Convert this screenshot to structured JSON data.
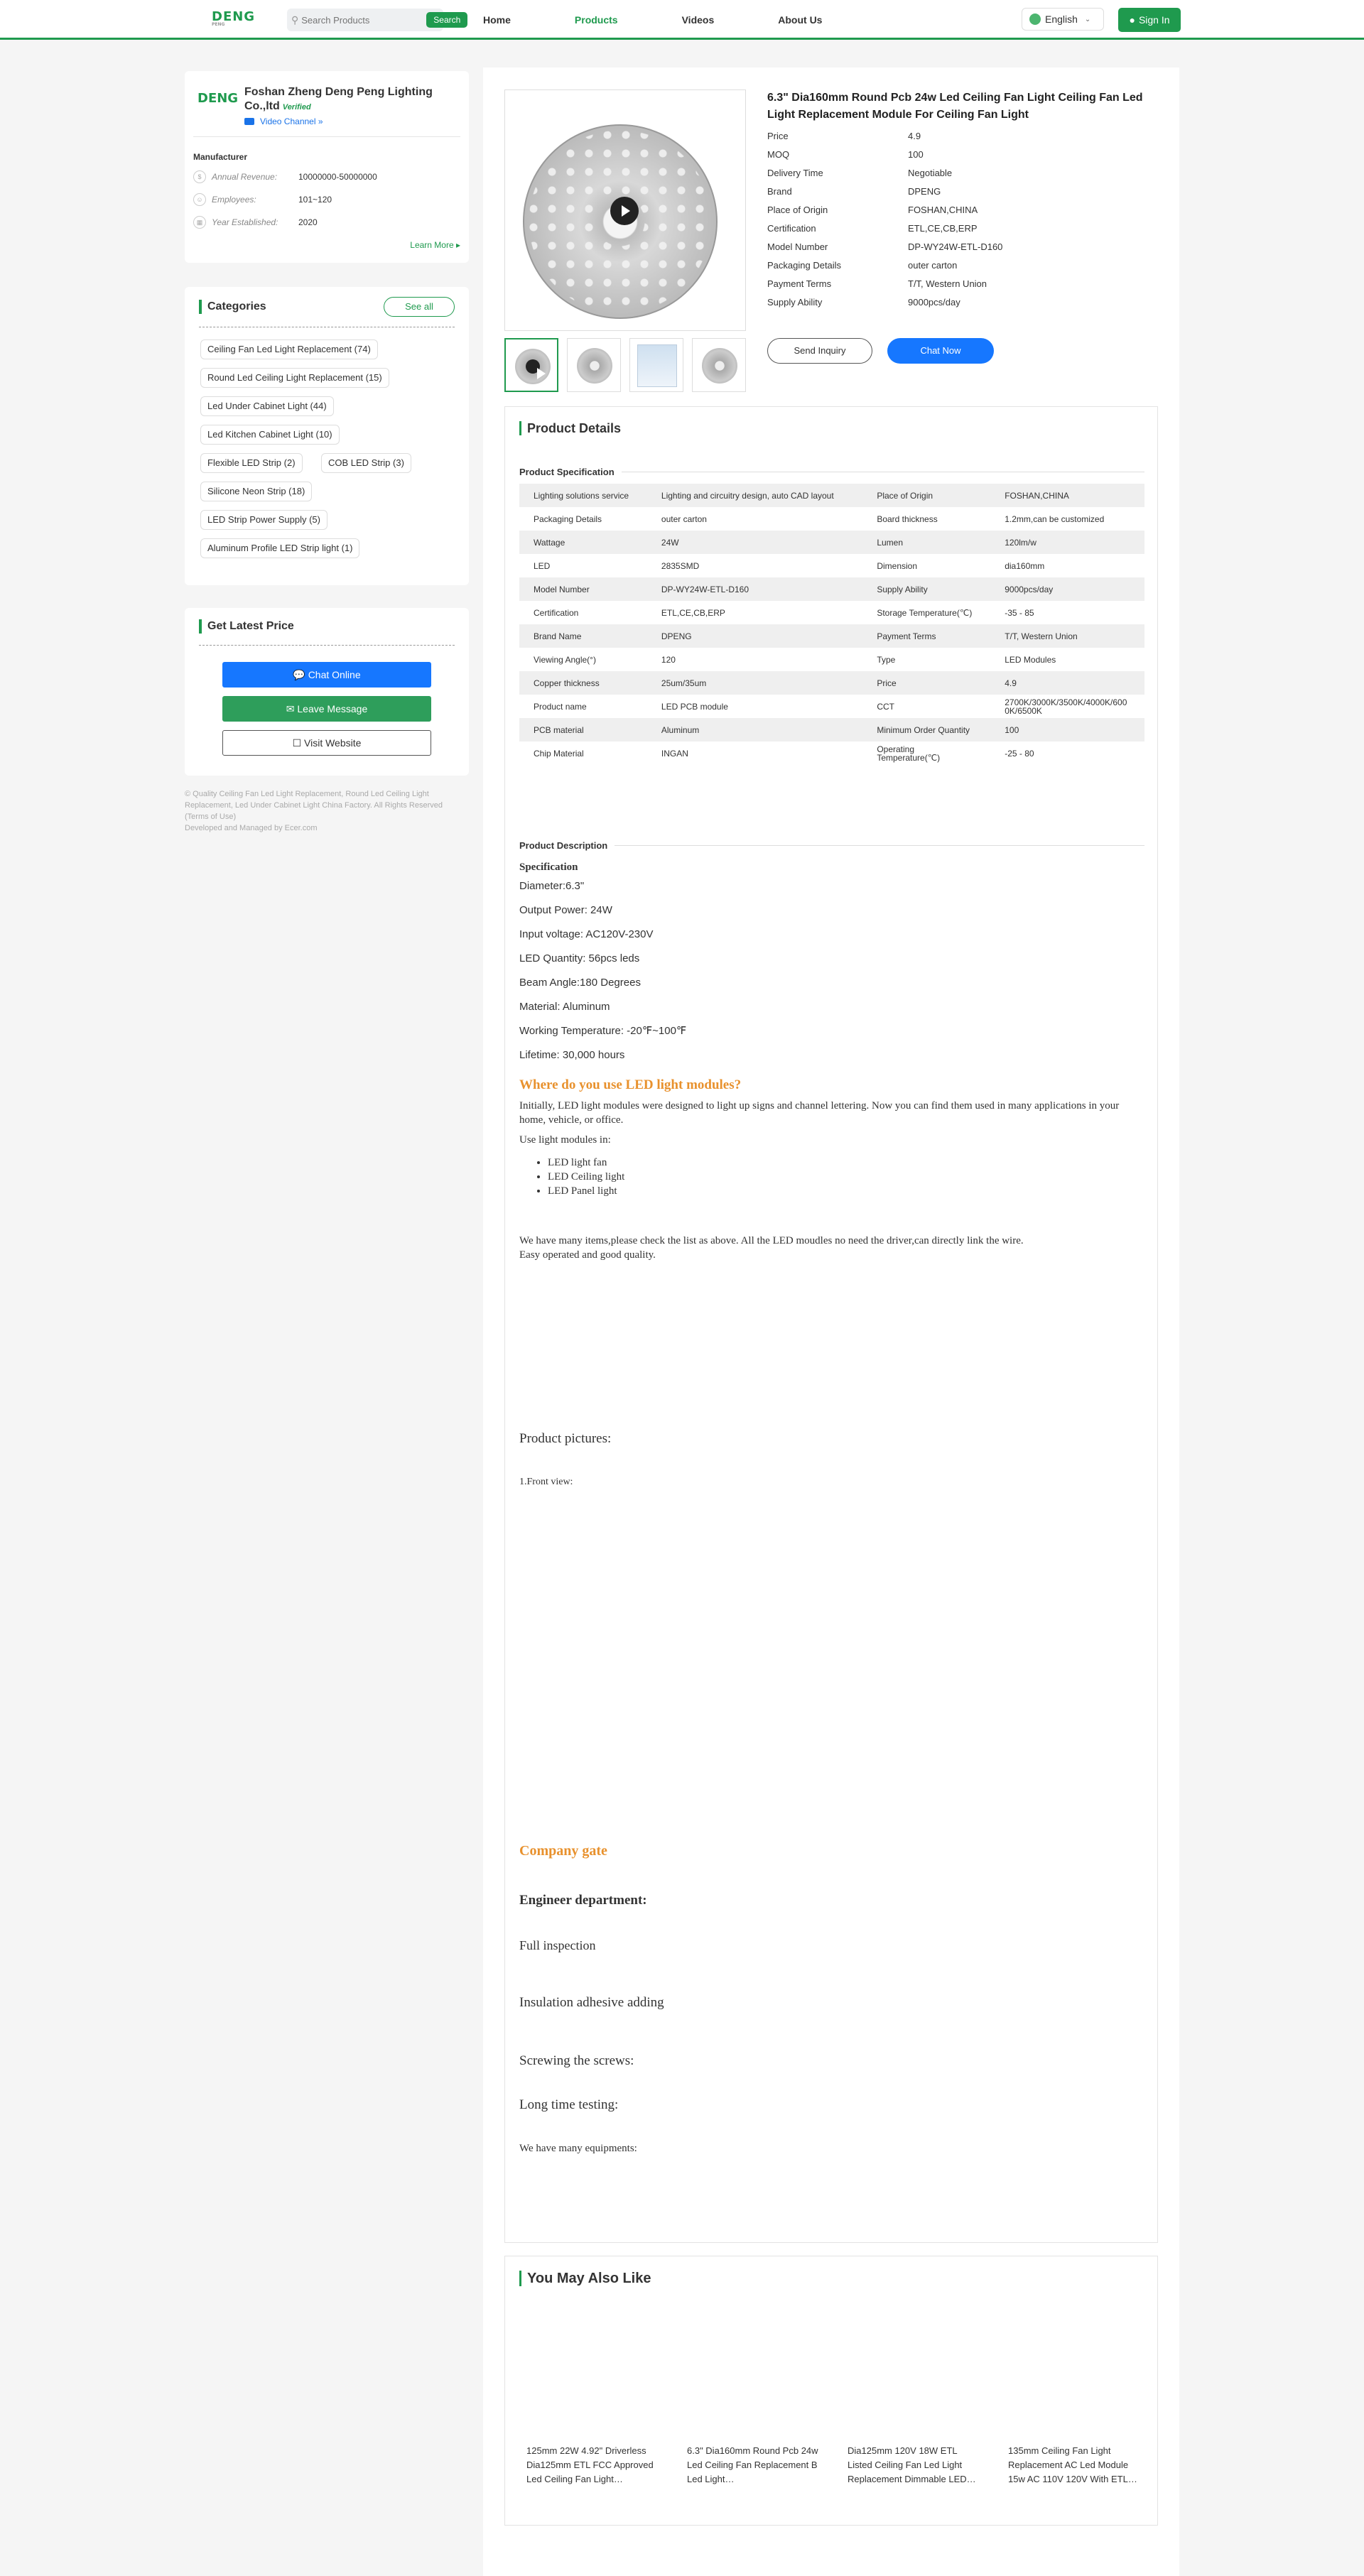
{
  "header": {
    "logo": "DENG",
    "logo_sub": "PENG",
    "search_placeholder": "Search Products",
    "search_button": "Search",
    "nav": [
      "Home",
      "Products",
      "Videos",
      "About Us"
    ],
    "language": "English",
    "signin": "Sign In"
  },
  "company": {
    "name": "Foshan Zheng Deng Peng Lighting Co.,ltd",
    "verified": "Verified",
    "video_channel": "Video Channel",
    "section": "Manufacturer",
    "stats": [
      {
        "label": "Annual Revenue:",
        "value": "10000000-50000000"
      },
      {
        "label": "Employees:",
        "value": "101~120"
      },
      {
        "label": "Year Established:",
        "value": "2020"
      }
    ],
    "learn_more": "Learn More"
  },
  "categories": {
    "title": "Categories",
    "see_all": "See all",
    "items": [
      "Ceiling Fan Led Light Replacement  (74)",
      "Round Led Ceiling Light Replacement  (15)",
      "Led Under Cabinet Light  (44)",
      "Led Kitchen Cabinet Light  (10)",
      "Flexible LED Strip  (2)",
      "COB LED Strip  (3)",
      "Silicone Neon Strip  (18)",
      "LED Strip Power Supply  (5)",
      "Aluminum Profile LED Strip light  (1)"
    ]
  },
  "latest_price": {
    "title": "Get Latest Price",
    "chat": "Chat Online",
    "message": "Leave Message",
    "website": "Visit Website"
  },
  "footnote": {
    "line1": "© Quality Ceiling Fan Led Light Replacement, Round Led Ceiling Light Replacement, Led Under Cabinet Light China Factory. All Rights Reserved",
    "line2": "(Terms of Use)",
    "line3": "Developed and Managed by Ecer.com"
  },
  "product": {
    "title": "6.3\" Dia160mm Round Pcb 24w Led Ceiling Fan Light Ceiling Fan Led Light Replacement Module For Ceiling Fan Light",
    "attrs": [
      {
        "k": "Price",
        "v": "4.9"
      },
      {
        "k": "MOQ",
        "v": "100"
      },
      {
        "k": "Delivery Time",
        "v": "Negotiable"
      },
      {
        "k": "Brand",
        "v": "DPENG"
      },
      {
        "k": "Place of Origin",
        "v": "FOSHAN,CHINA"
      },
      {
        "k": "Certification",
        "v": "ETL,CE,CB,ERP"
      },
      {
        "k": "Model Number",
        "v": "DP-WY24W-ETL-D160"
      },
      {
        "k": "Packaging Details",
        "v": "outer carton"
      },
      {
        "k": "Payment Terms",
        "v": "T/T, Western Union"
      },
      {
        "k": "Supply Ability",
        "v": "9000pcs/day"
      }
    ],
    "send_inquiry": "Send Inquiry",
    "chat_now": "Chat Now"
  },
  "details": {
    "title": "Product Details",
    "spec_heading": "Product Specification",
    "spec_rows": [
      [
        "Lighting solutions service",
        "Lighting and circuitry design, auto CAD layout",
        "Place of Origin",
        "FOSHAN,CHINA"
      ],
      [
        "Packaging Details",
        "outer carton",
        "Board thickness",
        "1.2mm,can be customized"
      ],
      [
        "Wattage",
        "24W",
        "Lumen",
        "120lm/w"
      ],
      [
        "LED",
        "2835SMD",
        "Dimension",
        "dia160mm"
      ],
      [
        "Model Number",
        "DP-WY24W-ETL-D160",
        "Supply Ability",
        "9000pcs/day"
      ],
      [
        "Certification",
        "ETL,CE,CB,ERP",
        "Storage Temperature(℃)",
        "-35 - 85"
      ],
      [
        "Brand Name",
        "DPENG",
        "Payment Terms",
        "T/T, Western Union"
      ],
      [
        "Viewing Angle(°)",
        "120",
        "Type",
        "LED Modules"
      ],
      [
        "Copper thickness",
        "25um/35um",
        "Price",
        "4.9"
      ],
      [
        "Product name",
        "LED PCB module",
        "CCT",
        "2700K/3000K/3500K/4000K/6000K/6500K"
      ],
      [
        "PCB material",
        "Aluminum",
        "Minimum Order Quantity",
        "100"
      ],
      [
        "Chip Material",
        "INGAN",
        "Operating Temperature(℃)",
        "-25 - 80"
      ]
    ],
    "desc_heading": "Product Description",
    "spec_label": "Specification",
    "spec_lines": [
      "Diameter:6.3\"",
      "Output Power: 24W",
      "Input voltage: AC120V-230V",
      "LED Quantity: 56pcs leds",
      "Beam Angle:180 Degrees",
      "Material: Aluminum",
      "Working Temperature: -20℉~100℉",
      "Lifetime: 30,000 hours"
    ],
    "where_heading": "Where do you use LED light modules?",
    "where_para": "Initially, LED light modules were designed to light up signs and channel lettering. Now you can find them used in many applications in your home, vehicle, or office.",
    "use_label": "Use light modules in:",
    "use_items": [
      "LED light fan",
      "LED Ceiling light",
      "LED Panel light"
    ],
    "many_items_1": "We have many items,please check the list as above. All the LED moudles no need the driver,can directly link the wire.",
    "many_items_2": "Easy operated and good quality.",
    "pictures": "Product pictures:",
    "front_view": "1.Front view:",
    "company_gate": "Company gate",
    "engineer": "Engineer department:",
    "full_inspection": "Full inspection",
    "insulation": "Insulation adhesive adding",
    "screwing": "Screwing the screws:",
    "testing": "Long time testing:",
    "equipments": "We have many equipments:"
  },
  "also_like": {
    "title": "You May Also Like",
    "items": [
      "125mm 22W 4.92\" Driverless Dia125mm ETL FCC Approved Led Ceiling Fan Light…",
      "6.3\" Dia160mm Round Pcb 24w Led Ceiling Fan Replacement B Led Light…",
      "Dia125mm 120V 18W ETL Listed Ceiling Fan Led Light Replacement Dimmable LED…",
      "135mm Ceiling Fan Light Replacement AC Led Module 15w AC 110V 120V With ETL…"
    ]
  }
}
